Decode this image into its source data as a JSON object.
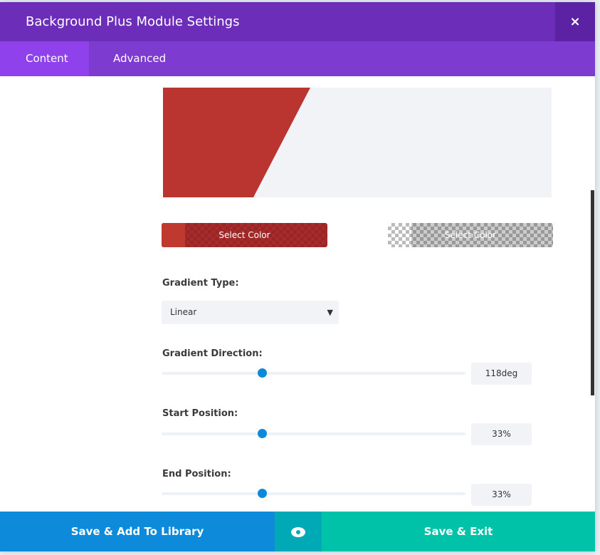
{
  "header": {
    "title": "Background Plus Module Settings",
    "close": "×"
  },
  "tabs": [
    {
      "label": "Content",
      "active": true
    },
    {
      "label": "Advanced",
      "active": false
    }
  ],
  "gradient": {
    "start_color": "#bb3530",
    "end_color": "transparent",
    "select_color_label": "Select Color",
    "type_label": "Gradient Type:",
    "type_value": "Linear",
    "direction_label": "Gradient Direction:",
    "direction_value": "118deg",
    "direction_fraction": 0.33,
    "start_label": "Start Position:",
    "start_value": "33%",
    "start_fraction": 0.33,
    "end_label": "End Position:",
    "end_value": "33%",
    "end_fraction": 0.33
  },
  "footer": {
    "save_library": "Save & Add To Library",
    "save_exit": "Save & Exit"
  }
}
